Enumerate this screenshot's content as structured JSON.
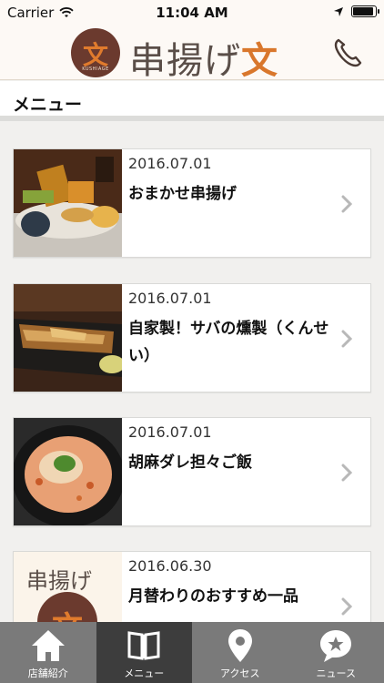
{
  "status_bar": {
    "carrier": "Carrier",
    "time": "11:04 AM"
  },
  "header": {
    "logo_kanji": "文",
    "logo_sub": "KUSHIAGE",
    "brand_prefix": "串揚げ",
    "brand_accent": "文",
    "phone_icon": "phone-icon"
  },
  "section": {
    "title": "メニュー"
  },
  "menu_items": [
    {
      "date": "2016.07.01",
      "title": "おまかせ串揚げ"
    },
    {
      "date": "2016.07.01",
      "title": "自家製！サバの燻製（くんせい）"
    },
    {
      "date": "2016.07.01",
      "title": "胡麻ダレ担々ご飯"
    },
    {
      "date": "2016.06.30",
      "title": "月替わりのおすすめ一品"
    }
  ],
  "thumb4": {
    "text": "串揚げ",
    "kanji": "文"
  },
  "tabs": [
    {
      "label": "店舗紹介",
      "icon": "home-icon",
      "active": false
    },
    {
      "label": "メニュー",
      "icon": "book-icon",
      "active": true
    },
    {
      "label": "アクセス",
      "icon": "map-pin-icon",
      "active": false
    },
    {
      "label": "ニュース",
      "icon": "star-bubble-icon",
      "active": false
    }
  ],
  "colors": {
    "brand_brown": "#6b3a2e",
    "brand_orange": "#d9772c",
    "tab_bar": "#7a7a7a",
    "tab_active": "#3d3d3d"
  }
}
